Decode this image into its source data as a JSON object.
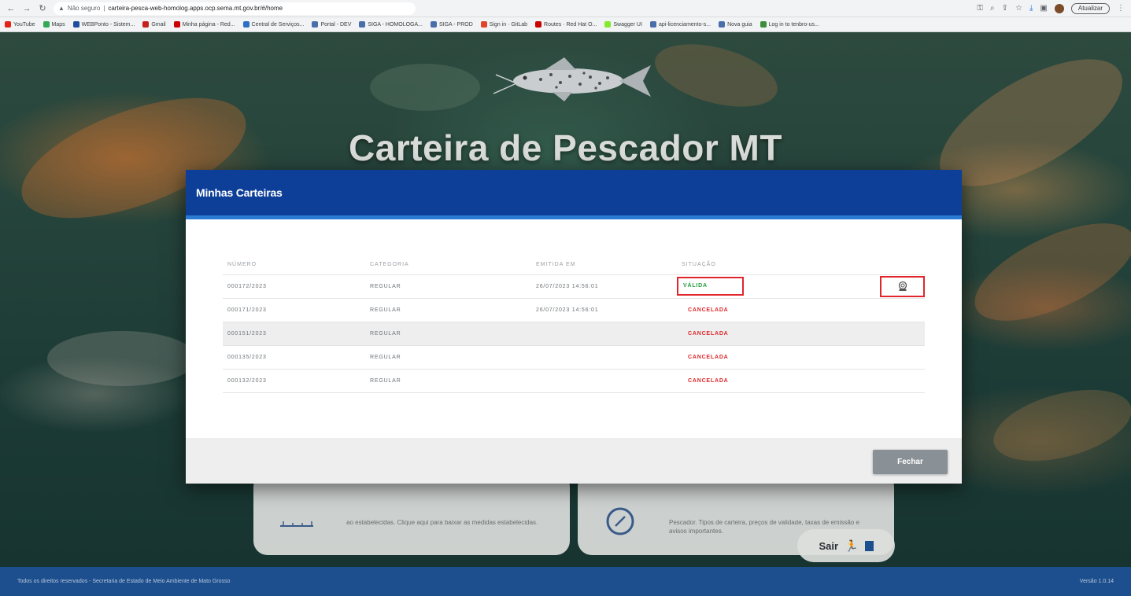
{
  "browser": {
    "security_label": "Não seguro",
    "url": "carteira-pesca-web-homolog.apps.ocp.sema.mt.gov.br/#/home",
    "update_label": "Atualizar",
    "bookmarks": [
      {
        "label": "YouTube",
        "icon": "youtube-icon",
        "color": "#e62117"
      },
      {
        "label": "Maps",
        "icon": "maps-icon",
        "color": "#34a853"
      },
      {
        "label": "WEBPonto - Sistem...",
        "icon": "webponto-icon",
        "color": "#1f4e9c"
      },
      {
        "label": "Gmail",
        "icon": "gmail-icon",
        "color": "#c5221f"
      },
      {
        "label": "Minha página - Red...",
        "icon": "redhat-icon",
        "color": "#cc0000"
      },
      {
        "label": "Central de Serviços...",
        "icon": "service-icon",
        "color": "#2b6fc6"
      },
      {
        "label": "Portal - DEV",
        "icon": "globe-icon",
        "color": "#4a6ea9"
      },
      {
        "label": "SIGA - HOMOLOGA...",
        "icon": "globe-icon",
        "color": "#4a6ea9"
      },
      {
        "label": "SIGA - PROD",
        "icon": "globe-icon",
        "color": "#4a6ea9"
      },
      {
        "label": "Sign in · GitLab",
        "icon": "gitlab-icon",
        "color": "#e24329"
      },
      {
        "label": "Routes · Red Hat O...",
        "icon": "openshift-icon",
        "color": "#cc0000"
      },
      {
        "label": "Swagger UI",
        "icon": "swagger-icon",
        "color": "#85ea2d"
      },
      {
        "label": "api-licenciamento-s...",
        "icon": "globe-icon",
        "color": "#4a6ea9"
      },
      {
        "label": "Nova guia",
        "icon": "globe-icon",
        "color": "#4a6ea9"
      },
      {
        "label": "Log in to tenbro-us...",
        "icon": "login-icon",
        "color": "#3b8f3b"
      }
    ]
  },
  "hero": {
    "title": "Carteira de Pescador MT"
  },
  "cards": {
    "left_text": "ao estabelecidas. Clique aqui para baixar as medidas estabelecidas.",
    "right_text": "Pescador. Tipos de carteira, preços de validade, taxas de emissão e avisos importantes."
  },
  "sair": {
    "label": "Sair"
  },
  "footer": {
    "left": "Todos os direitos reservados - Secretaria de Estado de Meio Ambiente de Mato Grosso",
    "right": "Versão 1.0.14"
  },
  "modal": {
    "title": "Minhas Carteiras",
    "columns": [
      "NÚMERO",
      "CATEGORIA",
      "EMITIDA EM",
      "SITUAÇÃO"
    ],
    "rows": [
      {
        "numero": "000172/2023",
        "categoria": "REGULAR",
        "emitida": "26/07/2023 14:56:01",
        "situacao": "VÁLIDA"
      },
      {
        "numero": "000171/2023",
        "categoria": "REGULAR",
        "emitida": "26/07/2023 14:56:01",
        "situacao": "CANCELADA"
      },
      {
        "numero": "000151/2023",
        "categoria": "REGULAR",
        "emitida": "",
        "situacao": "CANCELADA"
      },
      {
        "numero": "000135/2023",
        "categoria": "REGULAR",
        "emitida": "",
        "situacao": "CANCELADA"
      },
      {
        "numero": "000132/2023",
        "categoria": "REGULAR",
        "emitida": "",
        "situacao": "CANCELADA"
      }
    ],
    "close_label": "Fechar"
  },
  "colors": {
    "modal_header": "#0d3f99",
    "header_accent": "#2a7bd4",
    "valid": "#1f9a3a",
    "cancelled": "#e0262b",
    "highlight_box": "#e0262b",
    "footer_bg": "#1d4f8e",
    "close_button": "#8a9196"
  }
}
